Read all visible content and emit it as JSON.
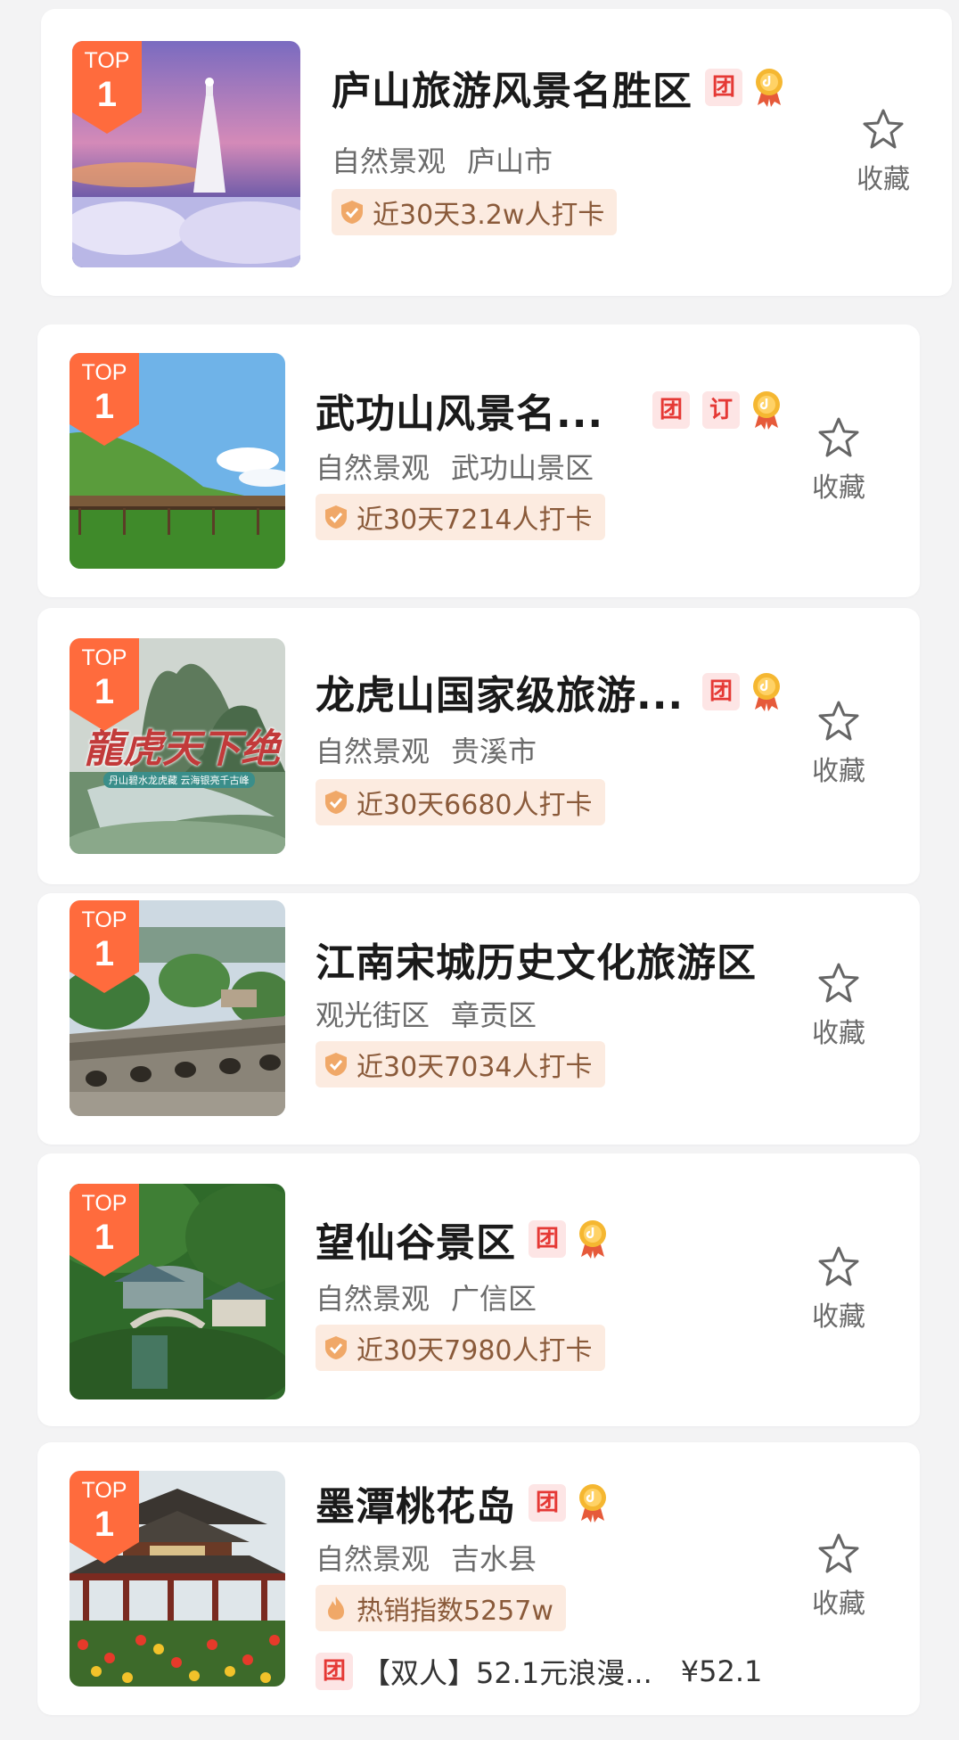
{
  "items": [
    {
      "rank_label": "TOP",
      "rank": "1",
      "title": "庐山旅游风景名胜区",
      "tags": [
        "团"
      ],
      "category": "自然景观",
      "location": "庐山市",
      "stat": "近30天3.2w人打卡",
      "favorite_label": "收藏"
    },
    {
      "rank_label": "TOP",
      "rank": "1",
      "title": "武功山风景名...",
      "tags": [
        "团",
        "订"
      ],
      "category": "自然景观",
      "location": "武功山景区",
      "stat": "近30天7214人打卡",
      "favorite_label": "收藏"
    },
    {
      "rank_label": "TOP",
      "rank": "1",
      "title": "龙虎山国家级旅游...",
      "tags": [
        "团"
      ],
      "category": "自然景观",
      "location": "贵溪市",
      "stat": "近30天6680人打卡",
      "favorite_label": "收藏",
      "image_text": "龍虎天下绝",
      "image_caption": "丹山碧水龙虎藏 云海银亮千古峰"
    },
    {
      "rank_label": "TOP",
      "rank": "1",
      "title": "江南宋城历史文化旅游区",
      "tags": [],
      "category": "观光街区",
      "location": "章贡区",
      "stat": "近30天7034人打卡",
      "favorite_label": "收藏"
    },
    {
      "rank_label": "TOP",
      "rank": "1",
      "title": "望仙谷景区",
      "tags": [
        "团"
      ],
      "category": "自然景观",
      "location": "广信区",
      "stat": "近30天7980人打卡",
      "favorite_label": "收藏"
    },
    {
      "rank_label": "TOP",
      "rank": "1",
      "title": "墨潭桃花岛",
      "tags": [
        "团"
      ],
      "category": "自然景观",
      "location": "吉水县",
      "stat": "热销指数5257w",
      "favorite_label": "收藏",
      "deal": {
        "tag": "团",
        "text": "【双人】52.1元浪漫...",
        "price": "¥52.1"
      }
    }
  ],
  "colors": {
    "rank_badge": "#ff6b3d",
    "tag_text": "#e53935",
    "tag_bg": "#fde5e5",
    "stat_bg": "#fcebe0",
    "medal": "#f5b731"
  },
  "icons": {
    "medal": "gold-medal-icon",
    "checkin": "verified-shield-icon",
    "hot": "flame-icon",
    "favorite": "star-outline-icon"
  }
}
